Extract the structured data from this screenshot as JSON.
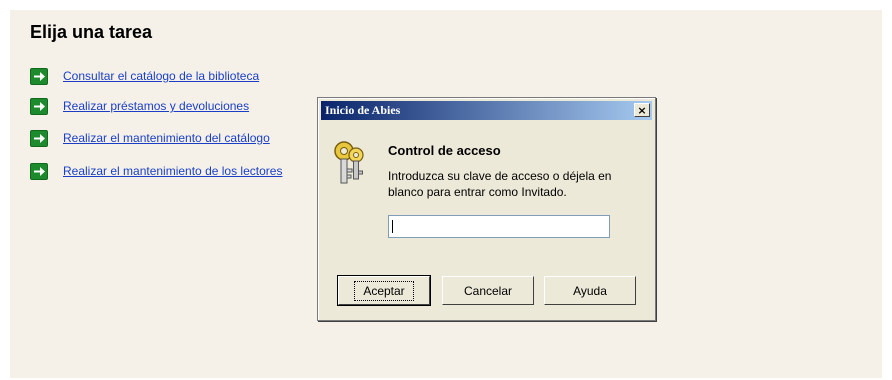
{
  "panel": {
    "title": "Elija una tarea",
    "tasks": [
      {
        "label": "Consultar el catálogo de la biblioteca",
        "icon": "arrow-right-icon"
      },
      {
        "label": "Realizar préstamos y devoluciones",
        "icon": "arrow-right-icon"
      },
      {
        "label": "Realizar el mantenimiento del catálogo",
        "icon": "arrow-right-icon"
      },
      {
        "label": "Realizar el mantenimiento de los lectores",
        "icon": "arrow-right-icon"
      }
    ]
  },
  "dialog": {
    "title": "Inicio de Abies",
    "close_glyph": "×",
    "icon": "keys-icon",
    "heading": "Control de acceso",
    "message": "Introduzca su clave de acceso o déjela en blanco para entrar como Invitado.",
    "password_value": "",
    "buttons": {
      "ok": "Aceptar",
      "cancel": "Cancelar",
      "help": "Ayuda"
    }
  },
  "colors": {
    "panel_bg": "#f5f1e9",
    "link": "#1a3fc6",
    "arrow_green": "#1d8a2e",
    "title_gradient_start": "#0a246a",
    "title_gradient_end": "#a6caf0"
  }
}
